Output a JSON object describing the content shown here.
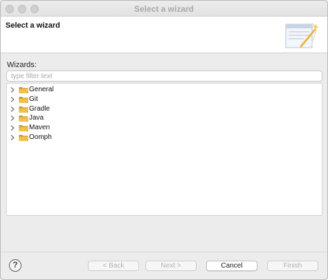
{
  "window": {
    "title": "Select a wizard"
  },
  "banner": {
    "title": "Select a wizard",
    "image_icon": "wizard-banner-icon"
  },
  "wizards": {
    "label": "Wizards:",
    "filter_placeholder": "type filter text",
    "filter_value": "",
    "items": [
      {
        "label": "General",
        "icon": "folder-icon",
        "expanded": false
      },
      {
        "label": "Git",
        "icon": "folder-icon",
        "expanded": false
      },
      {
        "label": "Gradle",
        "icon": "folder-icon",
        "expanded": false
      },
      {
        "label": "Java",
        "icon": "folder-icon",
        "expanded": false
      },
      {
        "label": "Maven",
        "icon": "folder-icon",
        "expanded": false
      },
      {
        "label": "Oomph",
        "icon": "folder-icon",
        "expanded": false
      }
    ]
  },
  "footer": {
    "help_icon": "help-icon",
    "back_label": "< Back",
    "next_label": "Next >",
    "cancel_label": "Cancel",
    "finish_label": "Finish"
  },
  "colors": {
    "folder": "#f0c14b",
    "folder_dark": "#c99a2e",
    "accent_wand": "#e8b84a"
  }
}
